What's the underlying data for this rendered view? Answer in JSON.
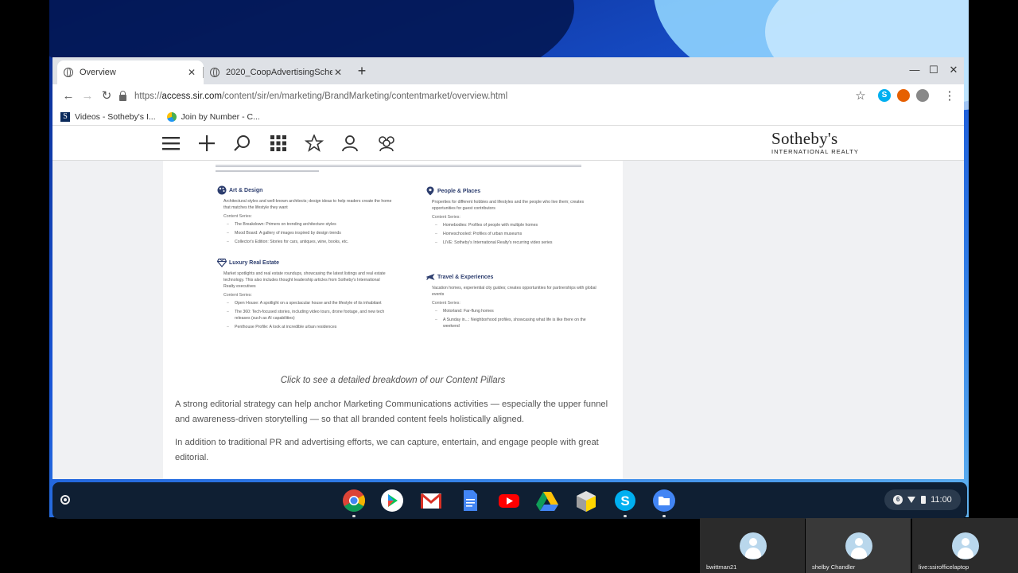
{
  "browser": {
    "tabs": [
      {
        "title": "Overview"
      },
      {
        "title": "2020_CoopAdvertisingSchedule..."
      }
    ],
    "url": {
      "scheme": "https://",
      "host": "access.sir.com",
      "path": "/content/sir/en/marketing/BrandMarketing/contentmarket/overview.html"
    },
    "bookmarks": [
      {
        "label": "Videos - Sotheby's I..."
      },
      {
        "label": "Join by Number - C..."
      }
    ]
  },
  "site": {
    "logo": {
      "name": "Sotheby's",
      "tagline": "INTERNATIONAL REALTY"
    },
    "pillars": [
      {
        "title": "Art & Design",
        "description": "Architectural styles and well-known architects; design ideas to help readers create the home that matches the lifestyle they want",
        "series_label": "Content Series:",
        "items": [
          "The Breakdown: Primers on trending architecture styles",
          "Mood Board: A gallery of images inspired by design trends",
          "Collector's Edition: Stories for cars, antiques, wine, books, etc."
        ]
      },
      {
        "title": "People & Places",
        "description": "Properties for different hobbies and lifestyles and the people who live them; creates opportunities for guest contributors",
        "series_label": "Content Series:",
        "items": [
          "Homebodies: Profiles of people with multiple homes",
          "Homeschooled: Profiles of urban museums",
          "LIVE: Sotheby's International Realty's recurring video series"
        ]
      },
      {
        "title": "Luxury Real Estate",
        "description": "Market spotlights and real estate roundups, showcasing the latest listings and real estate technology. This also includes thought leadership articles from Sotheby's International Realty executives",
        "series_label": "Content Series:",
        "items": [
          "Open House: A spotlight on a spectacular house and the lifestyle of its inhabitant",
          "The 360: Tech-focused stories, including video tours, drone footage, and new tech releases (such as AI capabilities)",
          "Penthouse Profile: A look at incredible urban residences"
        ]
      },
      {
        "title": "Travel & Experiences",
        "description": "Vacation homes, experiential city guides; creates opportunities for partnerships with global events",
        "series_label": "Content Series:",
        "items": [
          "Motorland: Far-flung homes",
          "A Sunday in...: Neighborhood profiles, showcasing what life is like there on the weekend"
        ]
      }
    ],
    "caption": "Click to see a detailed breakdown of our Content Pillars",
    "paragraph1": "A strong editorial strategy can help anchor Marketing Communications activities — especially the upper funnel and awareness-driven storytelling — so that all branded content feels holistically aligned.",
    "paragraph2": "In addition to traditional PR and advertising efforts, we can capture, entertain, and engage people with great editorial."
  },
  "shelf": {
    "apps": [
      "chrome",
      "play-store",
      "gmail",
      "docs",
      "youtube",
      "drive",
      "package",
      "skype",
      "files"
    ],
    "tray": {
      "badge": "6",
      "time": "11:00"
    }
  },
  "participants": [
    {
      "name": "bwittman21"
    },
    {
      "name": "shelby Chandler"
    },
    {
      "name": "live:ssirofficelaptop"
    }
  ],
  "colors": {
    "accent": "#2c3d6e",
    "shelf": "#0f1f33"
  }
}
